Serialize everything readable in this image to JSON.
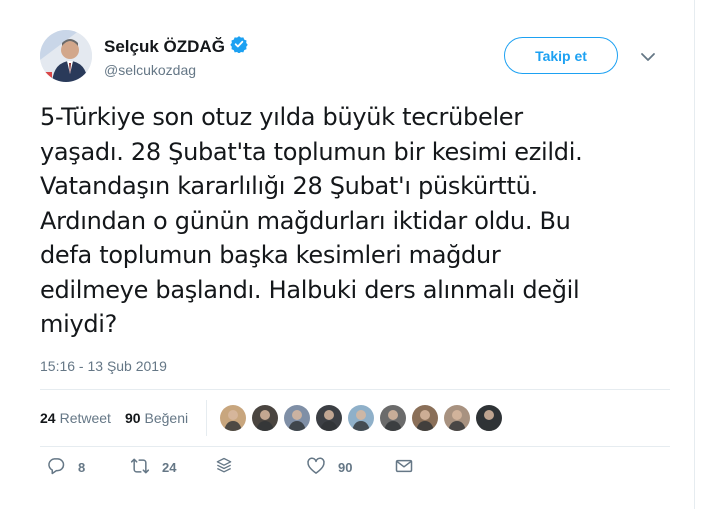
{
  "author": {
    "name": "Selçuk ÖZDAĞ",
    "handle": "@selcukozdag"
  },
  "follow_label": "Takip et",
  "tweet_text": "5-Türkiye son otuz yılda büyük tecrübeler\nyaşadı. 28 Şubat'ta toplumun bir kesimi ezildi.\nVatandaşın kararlılığı 28 Şubat'ı püskürttü.\nArdından o günün mağdurları iktidar oldu. Bu\ndefa toplumun başka kesimleri mağdur\nedilmeye başlandı. Halbuki ders alınmalı değil\nmiydi?",
  "timestamp": "15:16 - 13 Şub 2019",
  "stats": {
    "retweets_count": "24",
    "retweets_label": "Retweet",
    "likes_count": "90",
    "likes_label": "Beğeni"
  },
  "likers": [
    {
      "color": "#c8a67e"
    },
    {
      "color": "#4a4540"
    },
    {
      "color": "#7f8fa6"
    },
    {
      "color": "#3c3f44"
    },
    {
      "color": "#8fb0c9"
    },
    {
      "color": "#6b6b6b"
    },
    {
      "color": "#8a6f58"
    },
    {
      "color": "#a89280"
    },
    {
      "color": "#2f3336"
    }
  ],
  "actions": {
    "reply_count": "8",
    "retweet_count": "24",
    "like_count": "90"
  },
  "icons": {
    "verified": "verified-badge-icon",
    "caret": "chevron-down-icon",
    "reply": "reply-icon",
    "retweet": "retweet-icon",
    "stack": "layers-icon",
    "like": "heart-icon",
    "dm": "envelope-icon"
  },
  "colors": {
    "accent": "#1da1f2",
    "secondary_text": "#657786",
    "border": "#e6ecf0"
  }
}
